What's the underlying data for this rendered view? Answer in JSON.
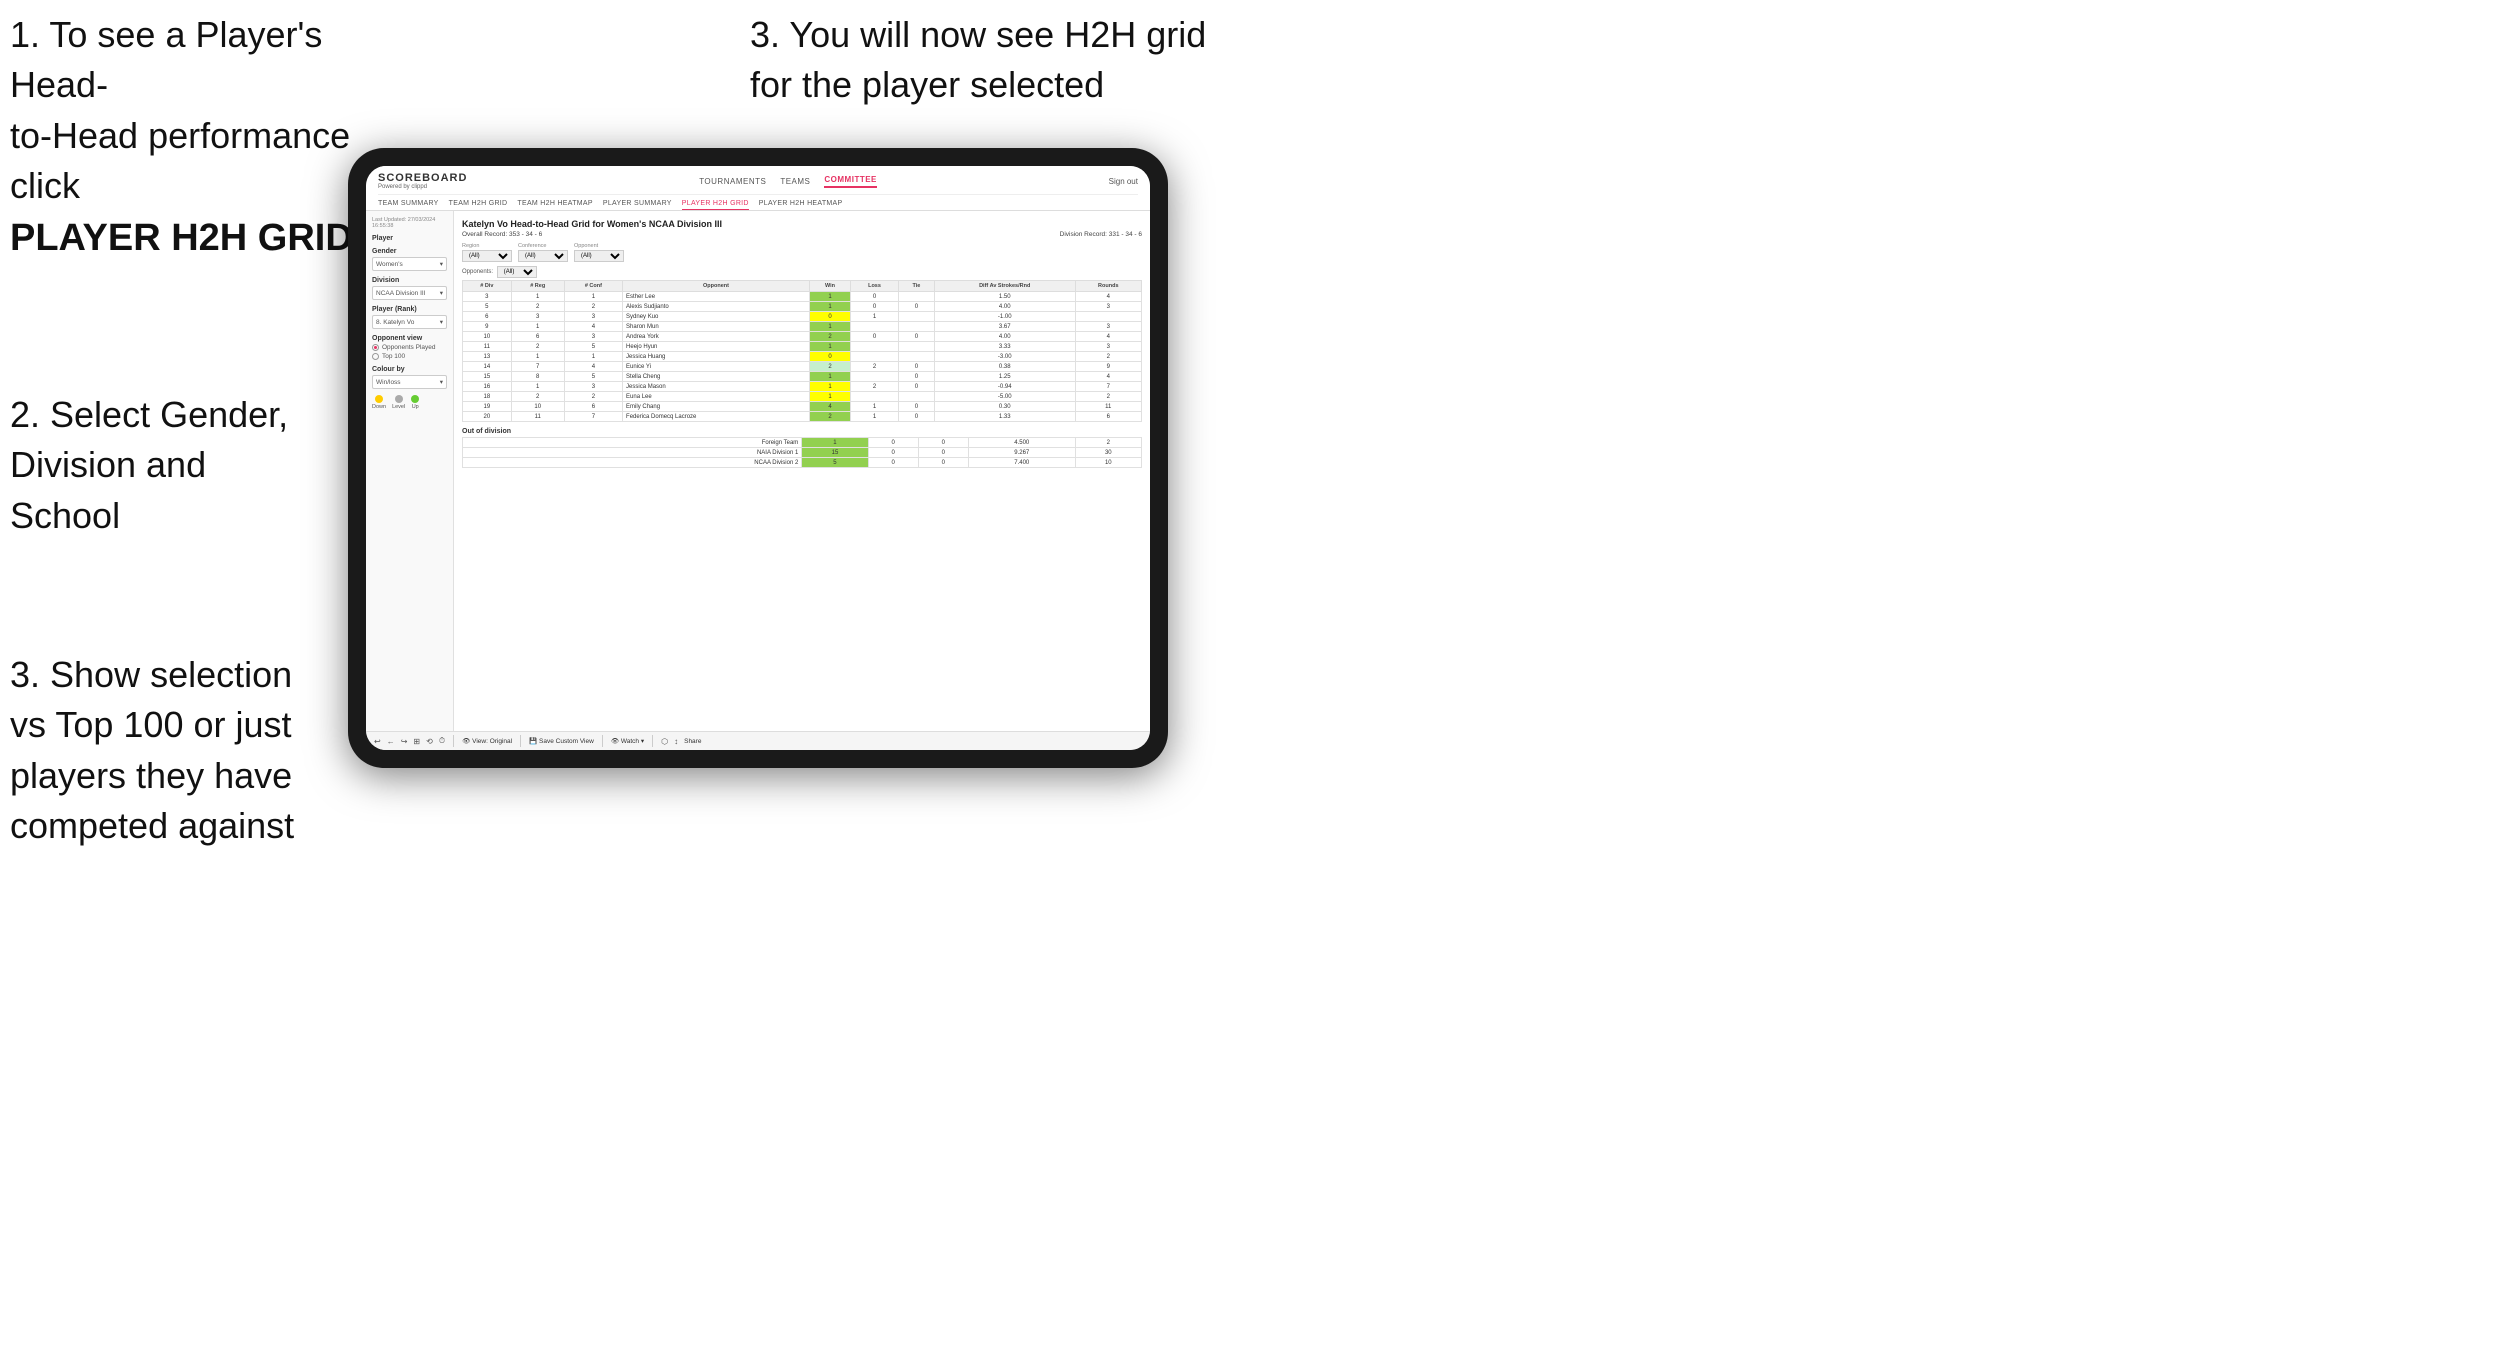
{
  "annotations": {
    "top_left": {
      "line1": "1. To see a Player's Head-",
      "line2": "to-Head performance click",
      "line3_bold": "PLAYER H2H GRID"
    },
    "top_right": {
      "line1": "3. You will now see H2H grid",
      "line2": "for the player selected"
    },
    "mid_left": {
      "line1": "2. Select Gender,",
      "line2": "Division and",
      "line3": "School"
    },
    "bottom_left": {
      "line1": "3. Show selection",
      "line2": "vs Top 100 or just",
      "line3": "players they have",
      "line4": "competed against"
    }
  },
  "nav": {
    "logo": "SCOREBOARD",
    "logo_sub": "Powered by clippd",
    "links": [
      "TOURNAMENTS",
      "TEAMS",
      "COMMITTEE"
    ],
    "active_link": "COMMITTEE",
    "sign_out": "Sign out",
    "sub_links": [
      "TEAM SUMMARY",
      "TEAM H2H GRID",
      "TEAM H2H HEATMAP",
      "PLAYER SUMMARY",
      "PLAYER H2H GRID",
      "PLAYER H2H HEATMAP"
    ],
    "active_sub": "PLAYER H2H GRID"
  },
  "sidebar": {
    "timestamp": "Last Updated: 27/03/2024 16:55:38",
    "player_label": "Player",
    "gender_label": "Gender",
    "gender_value": "Women's",
    "division_label": "Division",
    "division_value": "NCAA Division III",
    "player_rank_label": "Player (Rank)",
    "player_rank_value": "8. Katelyn Vo",
    "opponent_view_label": "Opponent view",
    "opponent_played": "Opponents Played",
    "top_100": "Top 100",
    "colour_by_label": "Colour by",
    "colour_by_value": "Win/loss",
    "legend_down": "Down",
    "legend_level": "Level",
    "legend_up": "Up"
  },
  "main": {
    "title": "Katelyn Vo Head-to-Head Grid for Women's NCAA Division III",
    "overall_record": "Overall Record: 353 - 34 - 6",
    "division_record": "Division Record: 331 - 34 - 6",
    "filter_opponents_label": "Opponents:",
    "filter_region_label": "Region",
    "filter_conference_label": "Conference",
    "filter_opponent_label": "Opponent",
    "filter_all": "(All)",
    "columns": [
      "# Div",
      "# Reg",
      "# Conf",
      "Opponent",
      "Win",
      "Loss",
      "Tie",
      "Diff Av Strokes/Rnd",
      "Rounds"
    ],
    "rows": [
      {
        "div": "3",
        "reg": "1",
        "conf": "1",
        "opponent": "Esther Lee",
        "win": "1",
        "loss": "0",
        "tie": "",
        "diff": "1.50",
        "rounds": "4",
        "win_color": "green"
      },
      {
        "div": "5",
        "reg": "2",
        "conf": "2",
        "opponent": "Alexis Sudjianto",
        "win": "1",
        "loss": "0",
        "tie": "0",
        "diff": "4.00",
        "rounds": "3",
        "win_color": "green"
      },
      {
        "div": "6",
        "reg": "3",
        "conf": "3",
        "opponent": "Sydney Kuo",
        "win": "0",
        "loss": "1",
        "tie": "",
        "diff": "-1.00",
        "rounds": "",
        "win_color": "yellow"
      },
      {
        "div": "9",
        "reg": "1",
        "conf": "4",
        "opponent": "Sharon Mun",
        "win": "1",
        "loss": "",
        "tie": "",
        "diff": "3.67",
        "rounds": "3",
        "win_color": "green"
      },
      {
        "div": "10",
        "reg": "6",
        "conf": "3",
        "opponent": "Andrea York",
        "win": "2",
        "loss": "0",
        "tie": "0",
        "diff": "4.00",
        "rounds": "4",
        "win_color": "green"
      },
      {
        "div": "11",
        "reg": "2",
        "conf": "5",
        "opponent": "Heejo Hyun",
        "win": "1",
        "loss": "",
        "tie": "",
        "diff": "3.33",
        "rounds": "3",
        "win_color": "green"
      },
      {
        "div": "13",
        "reg": "1",
        "conf": "1",
        "opponent": "Jessica Huang",
        "win": "0",
        "loss": "",
        "tie": "",
        "diff": "-3.00",
        "rounds": "2",
        "win_color": "yellow"
      },
      {
        "div": "14",
        "reg": "7",
        "conf": "4",
        "opponent": "Eunice Yi",
        "win": "2",
        "loss": "2",
        "tie": "0",
        "diff": "0.38",
        "rounds": "9",
        "win_color": "lightgreen"
      },
      {
        "div": "15",
        "reg": "8",
        "conf": "5",
        "opponent": "Stella Cheng",
        "win": "1",
        "loss": "",
        "tie": "0",
        "diff": "1.25",
        "rounds": "4",
        "win_color": "green"
      },
      {
        "div": "16",
        "reg": "1",
        "conf": "3",
        "opponent": "Jessica Mason",
        "win": "1",
        "loss": "2",
        "tie": "0",
        "diff": "-0.94",
        "rounds": "7",
        "win_color": "yellow"
      },
      {
        "div": "18",
        "reg": "2",
        "conf": "2",
        "opponent": "Euna Lee",
        "win": "1",
        "loss": "",
        "tie": "",
        "diff": "-5.00",
        "rounds": "2",
        "win_color": "yellow"
      },
      {
        "div": "19",
        "reg": "10",
        "conf": "6",
        "opponent": "Emily Chang",
        "win": "4",
        "loss": "1",
        "tie": "0",
        "diff": "0.30",
        "rounds": "11",
        "win_color": "green"
      },
      {
        "div": "20",
        "reg": "11",
        "conf": "7",
        "opponent": "Federica Domecq Lacroze",
        "win": "2",
        "loss": "1",
        "tie": "0",
        "diff": "1.33",
        "rounds": "6",
        "win_color": "green"
      }
    ],
    "out_of_division": "Out of division",
    "ood_rows": [
      {
        "opponent": "Foreign Team",
        "win": "1",
        "loss": "0",
        "tie": "0",
        "diff": "4.500",
        "rounds": "2",
        "win_color": "green"
      },
      {
        "opponent": "NAIA Division 1",
        "win": "15",
        "loss": "0",
        "tie": "0",
        "diff": "9.267",
        "rounds": "30",
        "win_color": "green"
      },
      {
        "opponent": "NCAA Division 2",
        "win": "5",
        "loss": "0",
        "tie": "0",
        "diff": "7.400",
        "rounds": "10",
        "win_color": "green"
      }
    ]
  },
  "toolbar": {
    "buttons": [
      "↩",
      "←",
      "↪",
      "⊞",
      "⟲",
      "⏱",
      "|",
      "View: Original",
      "|",
      "Save Custom View",
      "|",
      "👁 Watch ▾",
      "|",
      "⬡",
      "↕",
      "Share"
    ]
  }
}
